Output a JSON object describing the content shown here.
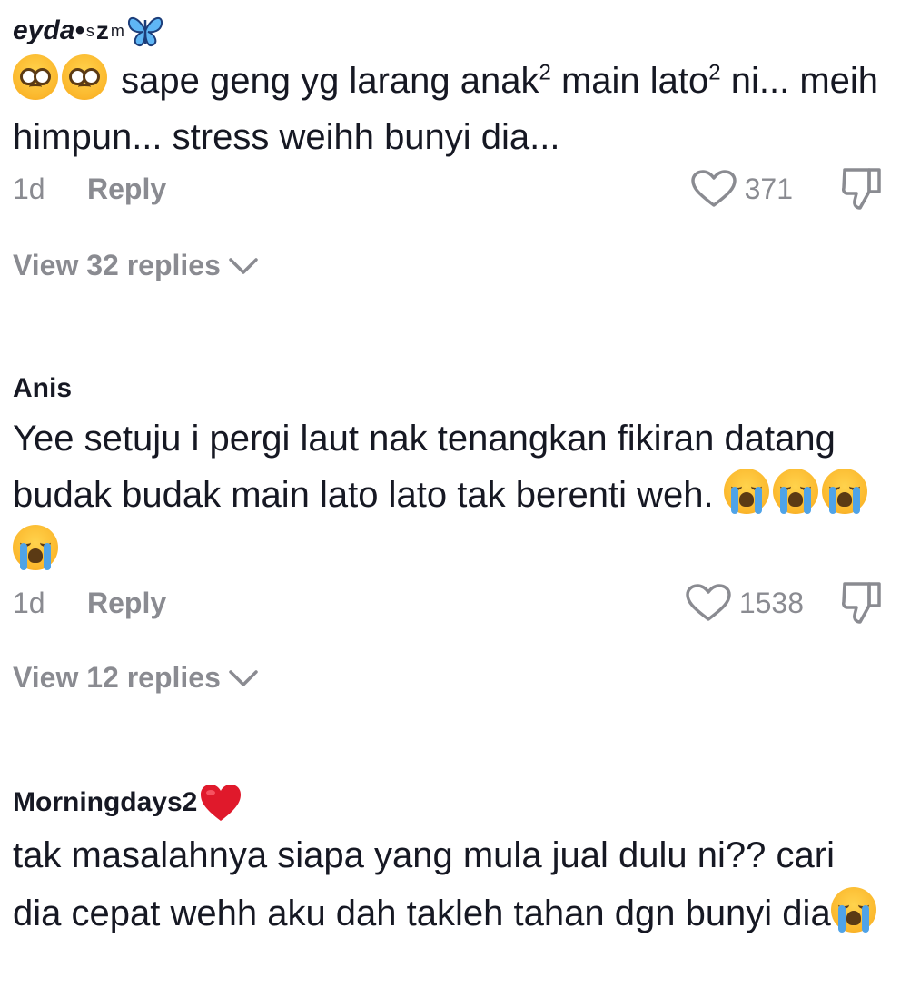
{
  "comments": [
    {
      "username_main": "eyda•",
      "username_small": "s",
      "username_z": "z",
      "username_m": "m",
      "text": "sape geng yg larang anak",
      "text_sup1": "2",
      "text_mid": " main lato",
      "text_sup2": "2",
      "text_end": " ni... meih himpun... stress weihh bunyi dia...",
      "time": "1d",
      "reply_label": "Reply",
      "likes": "371",
      "view_replies": "View 32 replies"
    },
    {
      "username": "Anis",
      "text": "Yee setuju i pergi laut nak tenangkan fikiran datang budak budak main lato lato tak berenti weh.",
      "time": "1d",
      "reply_label": "Reply",
      "likes": "1538",
      "view_replies": "View 12 replies"
    },
    {
      "username": "Morningdays2",
      "text": "tak masalahnya siapa yang mula jual dulu ni?? cari dia cepat wehh aku dah takleh tahan dgn bunyi dia"
    }
  ],
  "icons": {
    "butterfly": "butterfly-icon",
    "heart": "heart-icon",
    "dislike": "dislike-icon",
    "chevron": "chevron-down-icon",
    "red_heart": "red-heart-emoji",
    "pleading": "pleading-face-emoji",
    "crying": "loudly-crying-face-emoji"
  },
  "colors": {
    "text": "#161823",
    "muted": "#8a8b91",
    "emoji_yellow": "#fbb72c",
    "tear_blue": "#4fa3e8",
    "heart_red": "#e0192b"
  }
}
